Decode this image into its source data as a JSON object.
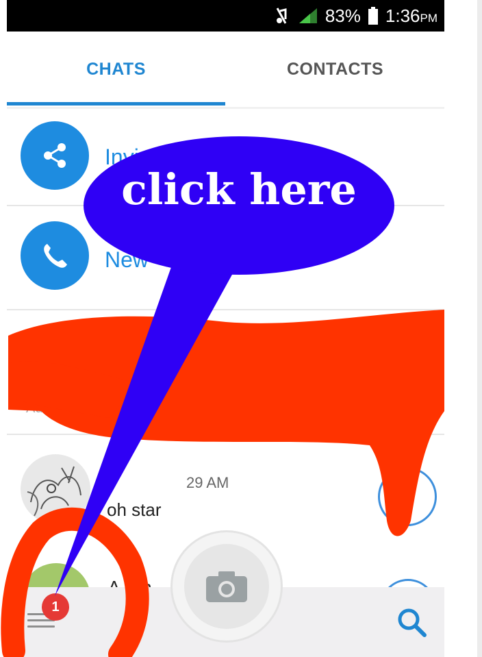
{
  "status_bar": {
    "battery": "83%",
    "time": "1:36",
    "time_suffix": "PM",
    "icons": [
      "muted-icon",
      "signal-icon",
      "battery-icon"
    ]
  },
  "tabs": [
    {
      "label": "CHATS",
      "active": true
    },
    {
      "label": "CONTACTS",
      "active": false
    }
  ],
  "actions": {
    "invite_label": "Invi",
    "new_call_label": "New"
  },
  "hidden_row": {
    "partial_text_left": "Add",
    "partial_text_right": "..."
  },
  "chats": [
    {
      "name": "29 AM",
      "preview": "oh star"
    },
    {
      "name": "A  l  kh",
      "preview": ""
    }
  ],
  "bottom_bar": {
    "badge_count": "1",
    "icons": [
      "menu-icon",
      "camera-icon",
      "search-icon"
    ]
  },
  "annotation": {
    "callout_text": "click here"
  },
  "colors": {
    "accent": "#1f86d1",
    "callout": "#2f00f5",
    "scribble": "#ff3300",
    "badge": "#e53935"
  }
}
